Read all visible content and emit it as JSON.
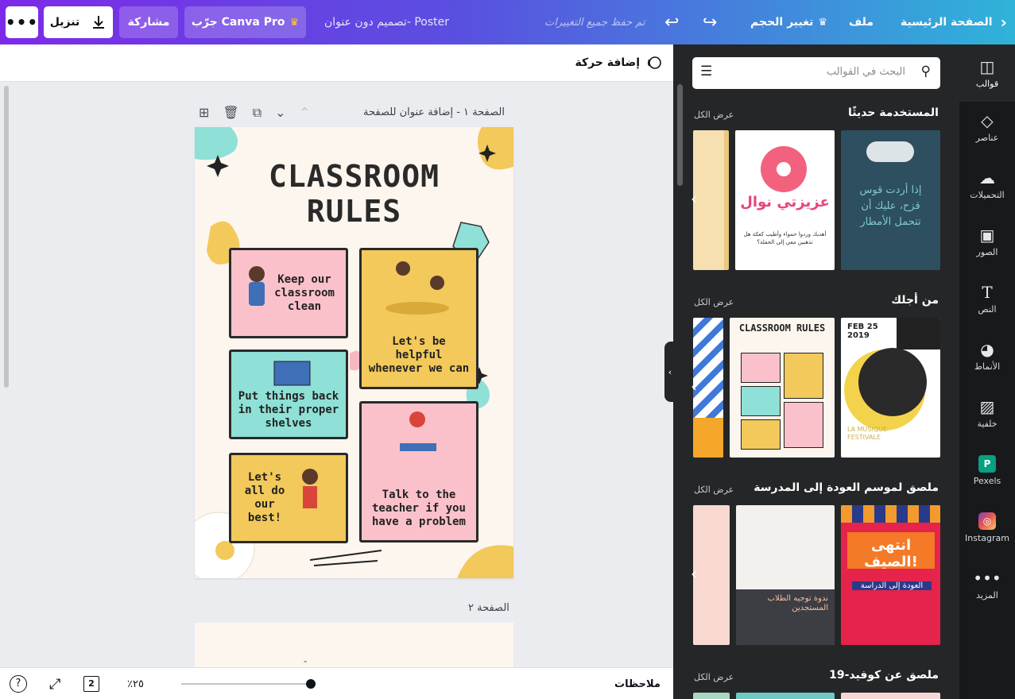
{
  "topbar": {
    "more_label": "•••",
    "download_label": "تنزيل",
    "share_label": "مشاركة",
    "try_pro_label": "جرّب Canva Pro",
    "doc_title": "تصميم دون عنوان- Poster",
    "saved_status": "تم حفظ جميع التغييرات",
    "resize_label": "تغيير الحجم",
    "file_label": "ملف",
    "home_label": "الصفحة الرئيسية"
  },
  "rail": {
    "items": [
      {
        "label": "قوالب",
        "icon": "templates-icon"
      },
      {
        "label": "عناصر",
        "icon": "elements-icon"
      },
      {
        "label": "التحميلات",
        "icon": "uploads-icon"
      },
      {
        "label": "الصور",
        "icon": "photos-icon"
      },
      {
        "label": "النص",
        "icon": "text-icon"
      },
      {
        "label": "الأنماط",
        "icon": "styles-icon"
      },
      {
        "label": "خلفية",
        "icon": "background-icon"
      },
      {
        "label": "Pexels",
        "icon": "pexels-icon"
      },
      {
        "label": "Instagram",
        "icon": "instagram-icon"
      },
      {
        "label": "المزيد",
        "icon": "more-icon"
      }
    ]
  },
  "panel": {
    "search_placeholder": "البحث في القوالب",
    "sections": [
      {
        "title": "المستخدمة حديثًا",
        "see_all": "عرض الكل"
      },
      {
        "title": "من أجلك",
        "see_all": "عرض الكل"
      },
      {
        "title": "ملصق لموسم العودة إلى المدرسة",
        "see_all": "عرض الكل"
      },
      {
        "title": "ملصق عن كوفيد-19",
        "see_all": "عرض الكل"
      }
    ],
    "thumbs": {
      "rain": "إذا أردت قوس قزح، عليك أن تتحمل الأمطار",
      "donut_title": "عزيزتي نوال",
      "donut_sub": "أهديك وردوا حمواء وأطيب كعكة هل تذهبين معي إلى الحفلة؟",
      "classroom_title": "CLASSROOM RULES",
      "concert_date": "FEB 25 2019",
      "concert_name": "LA MUSIQUE FESTIVALE",
      "summer": "انتهى الصيف!",
      "summer_sub": "العودة إلى الدراسة",
      "orientation": "ندوة توجيه الطلاب المستجدين"
    }
  },
  "canvas": {
    "add_animation": "إضافة حركة",
    "page1_label": "الصفحة ١ - إضافة عنوان للصفحة",
    "page2_label": "الصفحة ٢",
    "poster": {
      "title_line1": "CLASSROOM",
      "title_line2": "RULES",
      "rules": [
        "Keep our classroom clean",
        "Let's be helpful whenever we can",
        "Put things back in their proper shelves",
        "Talk to the teacher if you have a problem",
        "Let's all do our best!"
      ]
    }
  },
  "bottom": {
    "notes_label": "ملاحظات",
    "zoom": "٪٢٥",
    "page_count": "2",
    "help": "?"
  },
  "colors": {
    "accent_purple": "#7d2ae8",
    "accent_cyan": "#2fb3d9",
    "panel_bg": "#252627",
    "rail_bg": "#18191b"
  }
}
